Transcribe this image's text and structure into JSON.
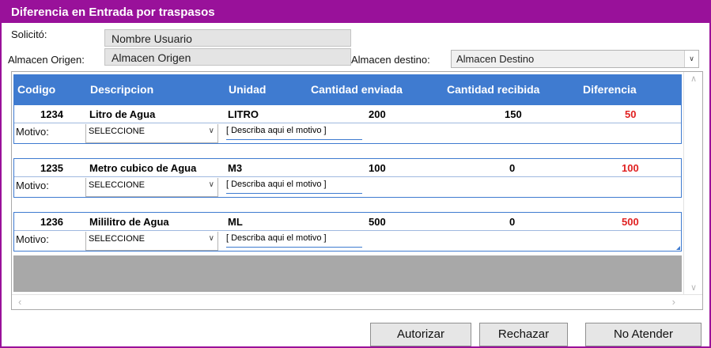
{
  "window": {
    "title": "Diferencia en Entrada por traspasos"
  },
  "form": {
    "solicito_label": "Solicitó:",
    "solicito_value": "Nombre Usuario",
    "origen_label": "Almacen Origen:",
    "origen_value": "Almacen Origen",
    "destino_label": "Almacen destino:",
    "destino_value": "Almacen Destino"
  },
  "table": {
    "columns": [
      "Codigo",
      "Descripcion",
      "Unidad",
      "Cantidad enviada",
      "Cantidad recibida",
      "Diferencia"
    ],
    "rows": [
      {
        "codigo": "1234",
        "descripcion": "Litro de Agua",
        "unidad": "LITRO",
        "enviada": "200",
        "recibida": "150",
        "diferencia": "50",
        "motivo_label": "Motivo:",
        "motivo_select": "SELECCIONE",
        "motivo_text": "[ Describa aqui el motivo ]"
      },
      {
        "codigo": "1235",
        "descripcion": "Metro cubico de Agua",
        "unidad": "M3",
        "enviada": "100",
        "recibida": "0",
        "diferencia": "100",
        "motivo_label": "Motivo:",
        "motivo_select": "SELECCIONE",
        "motivo_text": "[ Describa aqui el motivo ]"
      },
      {
        "codigo": "1236",
        "descripcion": "Mililitro de Agua",
        "unidad": "ML",
        "enviada": "500",
        "recibida": "0",
        "diferencia": "500",
        "motivo_label": "Motivo:",
        "motivo_select": "SELECCIONE",
        "motivo_text": "[ Describa aqui el motivo ]"
      }
    ]
  },
  "buttons": {
    "autorizar": "Autorizar",
    "rechazar": "Rechazar",
    "no_atender": "No Atender"
  },
  "colors": {
    "title_bar": "#99119a",
    "header": "#3f7bd0",
    "diferencia": "#e02020"
  }
}
